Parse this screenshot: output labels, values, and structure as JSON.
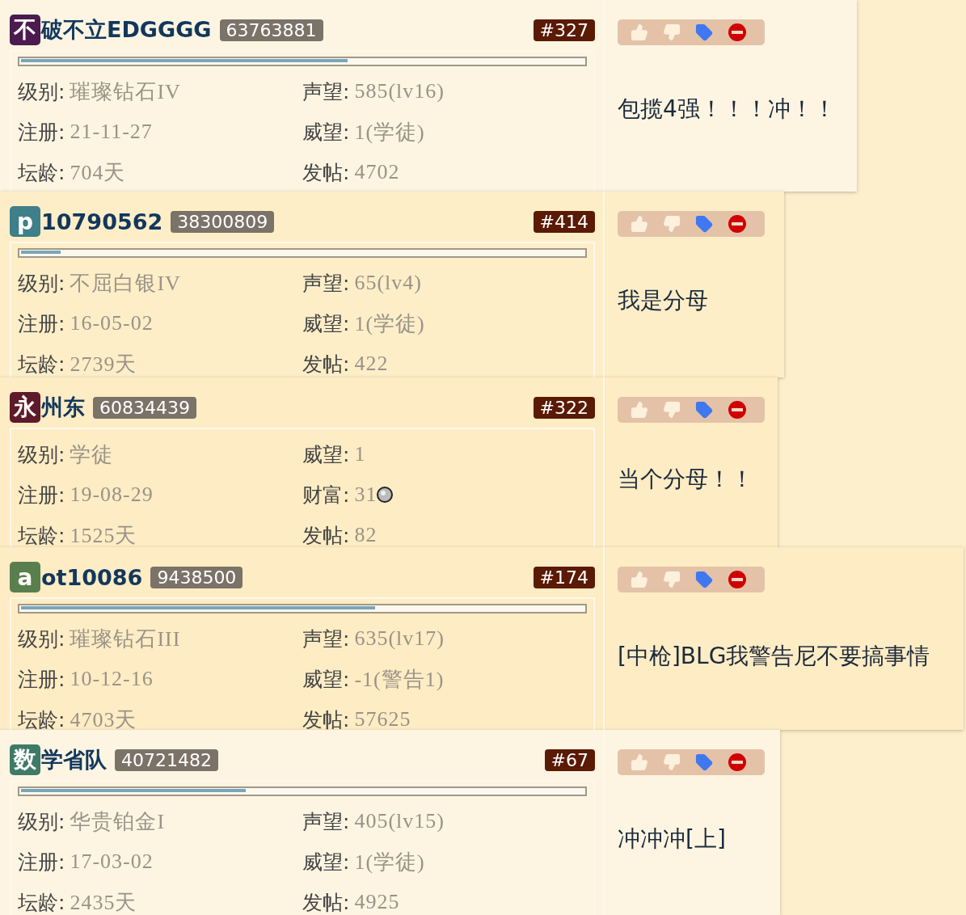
{
  "posts": [
    {
      "avatar": {
        "char": "不",
        "color": "#4b1a4f"
      },
      "name": "破不立EDGGGG",
      "uid": "63763881",
      "floor": "#327",
      "level": 0.58,
      "stats": [
        {
          "kind": "text",
          "label": "级别:",
          "value": "璀璨钻石IV"
        },
        {
          "kind": "text",
          "label": "声望:",
          "value": "585(lv16)"
        },
        {
          "kind": "text",
          "label": "注册:",
          "value": "21-11-27"
        },
        {
          "kind": "text",
          "label": "威望:",
          "value": "1(学徒)"
        },
        {
          "kind": "text",
          "label": "坛龄:",
          "value": "704天"
        },
        {
          "kind": "text",
          "label": "发帖:",
          "value": "4702"
        }
      ],
      "content": "包揽4强！！！冲！！"
    },
    {
      "avatar": {
        "char": "p",
        "color": "#3e7f8a"
      },
      "name": "10790562",
      "uid": "38300809",
      "floor": "#414",
      "level": 0.07,
      "stats": [
        {
          "kind": "text",
          "label": "级别:",
          "value": "不屈白银IV"
        },
        {
          "kind": "text",
          "label": "声望:",
          "value": "65(lv4)"
        },
        {
          "kind": "text",
          "label": "注册:",
          "value": "16-05-02"
        },
        {
          "kind": "text",
          "label": "威望:",
          "value": "1(学徒)"
        },
        {
          "kind": "text",
          "label": "坛龄:",
          "value": "2739天"
        },
        {
          "kind": "text",
          "label": "发帖:",
          "value": "422"
        }
      ],
      "content": "我是分母"
    },
    {
      "avatar": {
        "char": "永",
        "color": "#5e1a2a"
      },
      "name": "州东",
      "uid": "60834439",
      "floor": "#322",
      "stats": [
        {
          "kind": "text",
          "label": "级别:",
          "value": "学徒"
        },
        {
          "kind": "text",
          "label": "威望:",
          "value": "1"
        },
        {
          "kind": "text",
          "label": "注册:",
          "value": "19-08-29"
        },
        {
          "kind": "wealth",
          "label": "财富:",
          "value": "31"
        },
        {
          "kind": "text",
          "label": "坛龄:",
          "value": "1525天"
        },
        {
          "kind": "text",
          "label": "发帖:",
          "value": "82"
        }
      ],
      "content": "当个分母！！"
    },
    {
      "avatar": {
        "char": "a",
        "color": "#5a7f4e"
      },
      "name": "ot10086",
      "uid": "9438500",
      "floor": "#174",
      "level": 0.63,
      "stats": [
        {
          "kind": "text",
          "label": "级别:",
          "value": "璀璨钻石III"
        },
        {
          "kind": "text",
          "label": "声望:",
          "value": "635(lv17)"
        },
        {
          "kind": "text",
          "label": "注册:",
          "value": "10-12-16"
        },
        {
          "kind": "text",
          "label": "威望:",
          "value": "-1(警告1)"
        },
        {
          "kind": "text",
          "label": "坛龄:",
          "value": "4703天"
        },
        {
          "kind": "text",
          "label": "发帖:",
          "value": "57625"
        }
      ],
      "content": "[中枪]BLG我警告尼不要搞事情"
    },
    {
      "avatar": {
        "char": "数",
        "color": "#3e7a66"
      },
      "name": "学省队",
      "uid": "40721482",
      "floor": "#67",
      "level": 0.4,
      "stats": [
        {
          "kind": "text",
          "label": "级别:",
          "value": "华贵铂金I"
        },
        {
          "kind": "text",
          "label": "声望:",
          "value": "405(lv15)"
        },
        {
          "kind": "text",
          "label": "注册:",
          "value": "17-03-02"
        },
        {
          "kind": "text",
          "label": "威望:",
          "value": "1(学徒)"
        },
        {
          "kind": "text",
          "label": "坛龄:",
          "value": "2435天"
        },
        {
          "kind": "text",
          "label": "发帖:",
          "value": "4925"
        }
      ],
      "content": "冲冲冲[上]"
    }
  ]
}
